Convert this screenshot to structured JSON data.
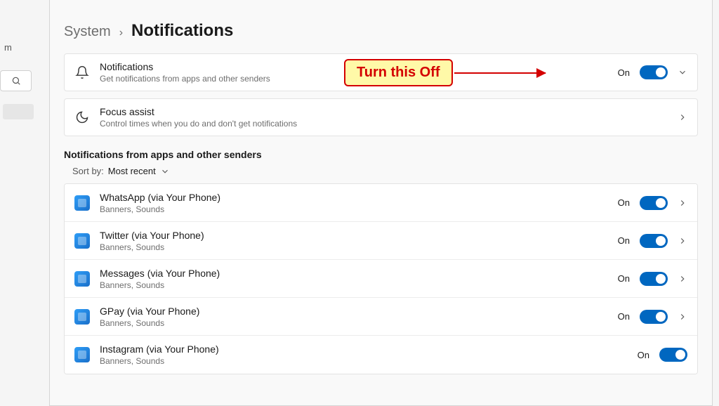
{
  "breadcrumb": {
    "parent": "System",
    "current": "Notifications"
  },
  "annotation": {
    "text": "Turn this Off"
  },
  "master": {
    "notifications": {
      "title": "Notifications",
      "subtitle": "Get notifications from apps and other senders",
      "state_label": "On"
    },
    "focus_assist": {
      "title": "Focus assist",
      "subtitle": "Control times when you do and don't get notifications"
    }
  },
  "section_header": "Notifications from apps and other senders",
  "sort": {
    "label": "Sort by:",
    "value": "Most recent"
  },
  "apps": [
    {
      "name": "WhatsApp (via Your Phone)",
      "sub": "Banners, Sounds",
      "state_label": "On"
    },
    {
      "name": "Twitter (via Your Phone)",
      "sub": "Banners, Sounds",
      "state_label": "On"
    },
    {
      "name": "Messages (via Your Phone)",
      "sub": "Banners, Sounds",
      "state_label": "On"
    },
    {
      "name": "GPay (via Your Phone)",
      "sub": "Banners, Sounds",
      "state_label": "On"
    },
    {
      "name": "Instagram (via Your Phone)",
      "sub": "Banners, Sounds",
      "state_label": "On"
    }
  ],
  "left_stub": "m"
}
